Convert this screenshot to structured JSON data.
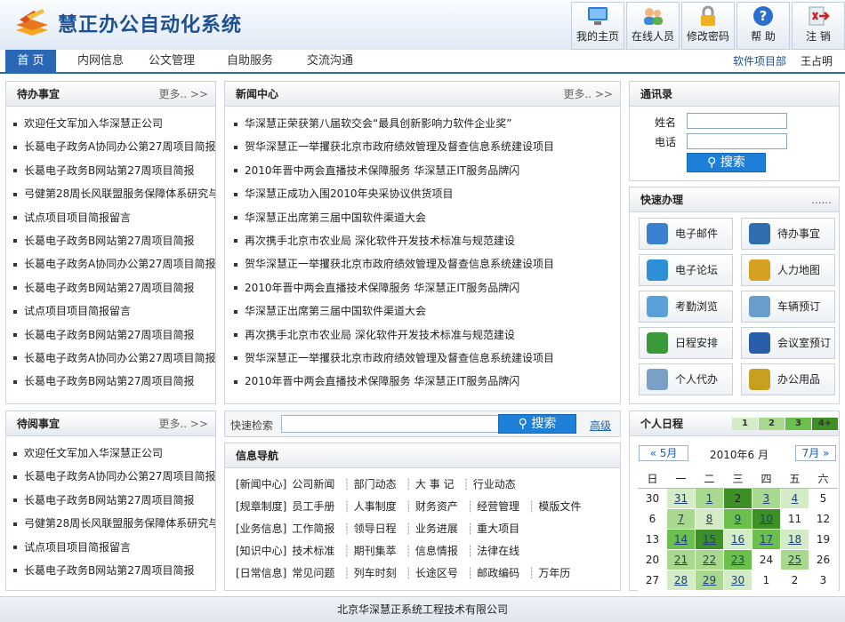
{
  "app": {
    "title": "慧正办公自动化系统"
  },
  "toolbar": [
    {
      "label": "我的主页",
      "icon": "monitor-icon"
    },
    {
      "label": "在线人员",
      "icon": "users-icon"
    },
    {
      "label": "修改密码",
      "icon": "lock-icon"
    },
    {
      "label": "帮 助",
      "icon": "help-icon"
    },
    {
      "label": "注 销",
      "icon": "logout-icon"
    }
  ],
  "nav": {
    "tabs": [
      "首 页",
      "内网信息",
      "公文管理",
      "自助服务",
      "交流沟通"
    ],
    "dept": "软件项目部",
    "user": "王占明"
  },
  "todo": {
    "title": "待办事宜",
    "more": "更多.. >>",
    "items": [
      "欢迎任文军加入华深慧正公司",
      "长葛电子政务A协同办公第27周项目简报",
      "长葛电子政务B网站第27周项目简报",
      "弓健第28周长风联盟服务保障体系研究与",
      "试点项目项目简报留言",
      "长葛电子政务B网站第27周项目简报",
      "长葛电子政务A协同办公第27周项目简报",
      "长葛电子政务B网站第27周项目简报",
      "试点项目项目简报留言",
      "长葛电子政务B网站第27周项目简报",
      "长葛电子政务A协同办公第27周项目简报",
      "长葛电子政务B网站第27周项目简报"
    ]
  },
  "toread": {
    "title": "待阅事宜",
    "more": "更多.. >>",
    "items": [
      "欢迎任文军加入华深慧正公司",
      "长葛电子政务A协同办公第27周项目简报",
      "长葛电子政务B网站第27周项目简报",
      "弓健第28周长风联盟服务保障体系研究与",
      "试点项目项目简报留言",
      "长葛电子政务B网站第27周项目简报"
    ]
  },
  "news": {
    "title": "新闻中心",
    "more": "更多.. >>",
    "items": [
      "华深慧正荣获第八届软交会“最具创新影响力软件企业奖”",
      "贺华深慧正一举攫获北京市政府绩效管理及督查信息系统建设项目",
      "2010年晋中两会直播技术保障服务 华深慧正IT服务品牌闪",
      "华深慧正成功入围2010年央采协议供货项目",
      "华深慧正出席第三届中国软件渠道大会",
      "再次携手北京市农业局 深化软件开发技术标准与规范建设",
      "贺华深慧正一举攫获北京市政府绩效管理及督查信息系统建设项目",
      "2010年晋中两会直播技术保障服务 华深慧正IT服务品牌闪",
      "华深慧正出席第三届中国软件渠道大会",
      "再次携手北京市农业局 深化软件开发技术标准与规范建设",
      "贺华深慧正一举攫获北京市政府绩效管理及督查信息系统建设项目",
      "2010年晋中两会直播技术保障服务 华深慧正IT服务品牌闪"
    ]
  },
  "search": {
    "label": "快速检索",
    "button": "搜索",
    "advanced": "高级"
  },
  "infonav": {
    "title": "信息导航",
    "rows": [
      [
        "[新闻中心]",
        "公司新闻",
        "部门动态",
        "大 事 记",
        "行业动态"
      ],
      [
        "[规章制度]",
        "员工手册",
        "人事制度",
        "财务资产",
        "经营管理",
        "模版文件"
      ],
      [
        "[业务信息]",
        "工作简报",
        "领导日程",
        "业务进展",
        "重大项目"
      ],
      [
        "[知识中心]",
        "技术标准",
        "期刊集萃",
        "信息情报",
        "法律在线"
      ],
      [
        "[日常信息]",
        "常见问题",
        "列车时刻",
        "长途区号",
        "邮政编码",
        "万年历"
      ]
    ]
  },
  "contacts": {
    "title": "通讯录",
    "name_label": "姓名",
    "phone_label": "电话",
    "button": "搜索"
  },
  "quick": {
    "title": "快速办理",
    "more": "......",
    "items": [
      {
        "label": "电子邮件",
        "icon": "email-icon",
        "color": "#3a7fd0"
      },
      {
        "label": "待办事宜",
        "icon": "todo-icon",
        "color": "#2f6fb0"
      },
      {
        "label": "电子论坛",
        "icon": "forum-icon",
        "color": "#2c8fd8"
      },
      {
        "label": "人力地图",
        "icon": "map-icon",
        "color": "#d6a020"
      },
      {
        "label": "考勤浏览",
        "icon": "calendar-grid-icon",
        "color": "#5aa0d8"
      },
      {
        "label": "车辆预订",
        "icon": "car-icon",
        "color": "#6a9ccc"
      },
      {
        "label": "日程安排",
        "icon": "globe-icon",
        "color": "#3a9a3a"
      },
      {
        "label": "会议室预订",
        "icon": "flag-icon",
        "color": "#2a5ea8"
      },
      {
        "label": "个人代办",
        "icon": "checklist-icon",
        "color": "#7aa0c8"
      },
      {
        "label": "办公用品",
        "icon": "supplies-icon",
        "color": "#c8a020"
      }
    ]
  },
  "schedule": {
    "title": "个人日程",
    "legend": [
      "1",
      "2",
      "3",
      "4+"
    ],
    "prev": "« 5月",
    "month": "2010年6 月",
    "next": "7月 »",
    "weekdays": [
      "日",
      "一",
      "二",
      "三",
      "四",
      "五",
      "六"
    ],
    "weeks": [
      [
        [
          "30",
          0,
          0
        ],
        [
          "31",
          1,
          1
        ],
        [
          "1",
          2,
          1
        ],
        [
          "2",
          4,
          0
        ],
        [
          "3",
          2,
          1
        ],
        [
          "4",
          1,
          1
        ],
        [
          "5",
          0,
          0
        ]
      ],
      [
        [
          "6",
          0,
          0
        ],
        [
          "7",
          2,
          1
        ],
        [
          "8",
          1,
          1
        ],
        [
          "9",
          3,
          1
        ],
        [
          "10",
          4,
          1
        ],
        [
          "11",
          0,
          0
        ],
        [
          "12",
          0,
          0
        ]
      ],
      [
        [
          "13",
          0,
          0
        ],
        [
          "14",
          3,
          1
        ],
        [
          "15",
          4,
          1
        ],
        [
          "16",
          1,
          1
        ],
        [
          "17",
          3,
          1
        ],
        [
          "18",
          1,
          1
        ],
        [
          "19",
          0,
          0
        ]
      ],
      [
        [
          "20",
          0,
          0
        ],
        [
          "21",
          2,
          1
        ],
        [
          "22",
          2,
          1
        ],
        [
          "23",
          3,
          1
        ],
        [
          "24",
          0,
          0
        ],
        [
          "25",
          2,
          1
        ],
        [
          "26",
          0,
          0
        ]
      ],
      [
        [
          "27",
          0,
          0
        ],
        [
          "28",
          1,
          1
        ],
        [
          "29",
          2,
          1
        ],
        [
          "30",
          1,
          1
        ],
        [
          "1",
          0,
          0
        ],
        [
          "2",
          0,
          0
        ],
        [
          "3",
          0,
          0
        ]
      ]
    ]
  },
  "footer": {
    "company": "北京华深慧正系统工程技术有限公司"
  }
}
